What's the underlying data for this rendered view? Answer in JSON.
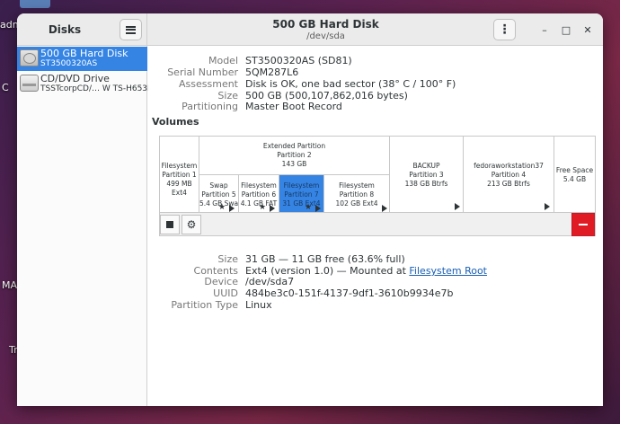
{
  "desktop": {
    "label_adm": "adm",
    "label_c": "C",
    "label_ma": "MA",
    "label_tr": "Tr"
  },
  "window": {
    "sidebar_title": "Disks",
    "title": "500 GB Hard Disk",
    "subtitle": "/dev/sda",
    "kebab": "⋮",
    "min": "–",
    "max": "□",
    "close": "✕"
  },
  "drives": [
    {
      "name": "500 GB Hard Disk",
      "sub": "ST3500320AS",
      "icon": "hard-disk-icon"
    },
    {
      "name": "CD/DVD Drive",
      "sub": "TSSTcorpCD/… W TS-H653L",
      "icon": "optical-drive-icon"
    }
  ],
  "disk_info": {
    "model_k": "Model",
    "model_v": "ST3500320AS (SD81)",
    "serial_k": "Serial Number",
    "serial_v": "5QM287L6",
    "assess_k": "Assessment",
    "assess_v": "Disk is OK, one bad sector (38° C / 100° F)",
    "size_k": "Size",
    "size_v": "500 GB (500,107,862,016 bytes)",
    "part_k": "Partitioning",
    "part_v": "Master Boot Record"
  },
  "volumes": {
    "title": "Volumes",
    "p1": {
      "l1": "Filesystem",
      "l2": "Partition 1",
      "l3": "499 MB Ext4"
    },
    "ext": {
      "l1": "Extended Partition",
      "l2": "Partition 2",
      "l3": "143 GB"
    },
    "p5": {
      "l1": "Swap",
      "l2": "Partition 5",
      "l3": "5.4 GB Swap"
    },
    "p6": {
      "l1": "Filesystem",
      "l2": "Partition 6",
      "l3": "4.1 GB FAT"
    },
    "p7": {
      "l1": "Filesystem",
      "l2": "Partition 7",
      "l3": "31 GB Ext4"
    },
    "p8": {
      "l1": "Filesystem",
      "l2": "Partition 8",
      "l3": "102 GB Ext4"
    },
    "p3": {
      "l1": "BACKUP",
      "l2": "Partition 3",
      "l3": "138 GB Btrfs"
    },
    "p4": {
      "l1": "fedoraworkstation37",
      "l2": "Partition 4",
      "l3": "213 GB Btrfs"
    },
    "free": {
      "l1": "Free Space",
      "l2": "5.4 GB"
    },
    "star": "★"
  },
  "selected_volume": {
    "size_k": "Size",
    "size_v": "31 GB — 11 GB free (63.6% full)",
    "contents_k": "Contents",
    "contents_v": "Ext4 (version 1.0) — Mounted at ",
    "contents_link": "Filesystem Root",
    "device_k": "Device",
    "device_v": "/dev/sda7",
    "uuid_k": "UUID",
    "uuid_v": "484be3c0-151f-4137-9df1-3610b9934e7b",
    "ptype_k": "Partition Type",
    "ptype_v": "Linux"
  },
  "colors": {
    "accent": "#3584e4",
    "danger": "#e01b24"
  }
}
